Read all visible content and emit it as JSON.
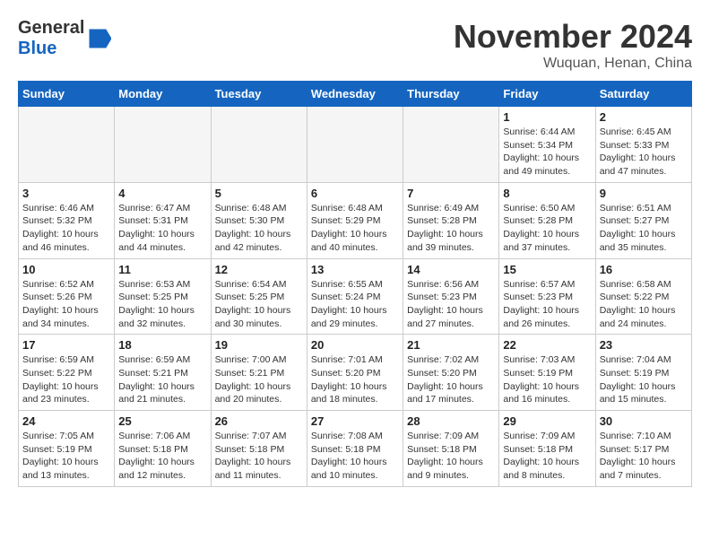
{
  "header": {
    "logo_general": "General",
    "logo_blue": "Blue",
    "month_title": "November 2024",
    "location": "Wuquan, Henan, China"
  },
  "calendar": {
    "days_of_week": [
      "Sunday",
      "Monday",
      "Tuesday",
      "Wednesday",
      "Thursday",
      "Friday",
      "Saturday"
    ],
    "weeks": [
      [
        {
          "day": "",
          "empty": true
        },
        {
          "day": "",
          "empty": true
        },
        {
          "day": "",
          "empty": true
        },
        {
          "day": "",
          "empty": true
        },
        {
          "day": "",
          "empty": true
        },
        {
          "day": "1",
          "sunrise": "Sunrise: 6:44 AM",
          "sunset": "Sunset: 5:34 PM",
          "daylight": "Daylight: 10 hours and 49 minutes."
        },
        {
          "day": "2",
          "sunrise": "Sunrise: 6:45 AM",
          "sunset": "Sunset: 5:33 PM",
          "daylight": "Daylight: 10 hours and 47 minutes."
        }
      ],
      [
        {
          "day": "3",
          "sunrise": "Sunrise: 6:46 AM",
          "sunset": "Sunset: 5:32 PM",
          "daylight": "Daylight: 10 hours and 46 minutes."
        },
        {
          "day": "4",
          "sunrise": "Sunrise: 6:47 AM",
          "sunset": "Sunset: 5:31 PM",
          "daylight": "Daylight: 10 hours and 44 minutes."
        },
        {
          "day": "5",
          "sunrise": "Sunrise: 6:48 AM",
          "sunset": "Sunset: 5:30 PM",
          "daylight": "Daylight: 10 hours and 42 minutes."
        },
        {
          "day": "6",
          "sunrise": "Sunrise: 6:48 AM",
          "sunset": "Sunset: 5:29 PM",
          "daylight": "Daylight: 10 hours and 40 minutes."
        },
        {
          "day": "7",
          "sunrise": "Sunrise: 6:49 AM",
          "sunset": "Sunset: 5:28 PM",
          "daylight": "Daylight: 10 hours and 39 minutes."
        },
        {
          "day": "8",
          "sunrise": "Sunrise: 6:50 AM",
          "sunset": "Sunset: 5:28 PM",
          "daylight": "Daylight: 10 hours and 37 minutes."
        },
        {
          "day": "9",
          "sunrise": "Sunrise: 6:51 AM",
          "sunset": "Sunset: 5:27 PM",
          "daylight": "Daylight: 10 hours and 35 minutes."
        }
      ],
      [
        {
          "day": "10",
          "sunrise": "Sunrise: 6:52 AM",
          "sunset": "Sunset: 5:26 PM",
          "daylight": "Daylight: 10 hours and 34 minutes."
        },
        {
          "day": "11",
          "sunrise": "Sunrise: 6:53 AM",
          "sunset": "Sunset: 5:25 PM",
          "daylight": "Daylight: 10 hours and 32 minutes."
        },
        {
          "day": "12",
          "sunrise": "Sunrise: 6:54 AM",
          "sunset": "Sunset: 5:25 PM",
          "daylight": "Daylight: 10 hours and 30 minutes."
        },
        {
          "day": "13",
          "sunrise": "Sunrise: 6:55 AM",
          "sunset": "Sunset: 5:24 PM",
          "daylight": "Daylight: 10 hours and 29 minutes."
        },
        {
          "day": "14",
          "sunrise": "Sunrise: 6:56 AM",
          "sunset": "Sunset: 5:23 PM",
          "daylight": "Daylight: 10 hours and 27 minutes."
        },
        {
          "day": "15",
          "sunrise": "Sunrise: 6:57 AM",
          "sunset": "Sunset: 5:23 PM",
          "daylight": "Daylight: 10 hours and 26 minutes."
        },
        {
          "day": "16",
          "sunrise": "Sunrise: 6:58 AM",
          "sunset": "Sunset: 5:22 PM",
          "daylight": "Daylight: 10 hours and 24 minutes."
        }
      ],
      [
        {
          "day": "17",
          "sunrise": "Sunrise: 6:59 AM",
          "sunset": "Sunset: 5:22 PM",
          "daylight": "Daylight: 10 hours and 23 minutes."
        },
        {
          "day": "18",
          "sunrise": "Sunrise: 6:59 AM",
          "sunset": "Sunset: 5:21 PM",
          "daylight": "Daylight: 10 hours and 21 minutes."
        },
        {
          "day": "19",
          "sunrise": "Sunrise: 7:00 AM",
          "sunset": "Sunset: 5:21 PM",
          "daylight": "Daylight: 10 hours and 20 minutes."
        },
        {
          "day": "20",
          "sunrise": "Sunrise: 7:01 AM",
          "sunset": "Sunset: 5:20 PM",
          "daylight": "Daylight: 10 hours and 18 minutes."
        },
        {
          "day": "21",
          "sunrise": "Sunrise: 7:02 AM",
          "sunset": "Sunset: 5:20 PM",
          "daylight": "Daylight: 10 hours and 17 minutes."
        },
        {
          "day": "22",
          "sunrise": "Sunrise: 7:03 AM",
          "sunset": "Sunset: 5:19 PM",
          "daylight": "Daylight: 10 hours and 16 minutes."
        },
        {
          "day": "23",
          "sunrise": "Sunrise: 7:04 AM",
          "sunset": "Sunset: 5:19 PM",
          "daylight": "Daylight: 10 hours and 15 minutes."
        }
      ],
      [
        {
          "day": "24",
          "sunrise": "Sunrise: 7:05 AM",
          "sunset": "Sunset: 5:19 PM",
          "daylight": "Daylight: 10 hours and 13 minutes."
        },
        {
          "day": "25",
          "sunrise": "Sunrise: 7:06 AM",
          "sunset": "Sunset: 5:18 PM",
          "daylight": "Daylight: 10 hours and 12 minutes."
        },
        {
          "day": "26",
          "sunrise": "Sunrise: 7:07 AM",
          "sunset": "Sunset: 5:18 PM",
          "daylight": "Daylight: 10 hours and 11 minutes."
        },
        {
          "day": "27",
          "sunrise": "Sunrise: 7:08 AM",
          "sunset": "Sunset: 5:18 PM",
          "daylight": "Daylight: 10 hours and 10 minutes."
        },
        {
          "day": "28",
          "sunrise": "Sunrise: 7:09 AM",
          "sunset": "Sunset: 5:18 PM",
          "daylight": "Daylight: 10 hours and 9 minutes."
        },
        {
          "day": "29",
          "sunrise": "Sunrise: 7:09 AM",
          "sunset": "Sunset: 5:18 PM",
          "daylight": "Daylight: 10 hours and 8 minutes."
        },
        {
          "day": "30",
          "sunrise": "Sunrise: 7:10 AM",
          "sunset": "Sunset: 5:17 PM",
          "daylight": "Daylight: 10 hours and 7 minutes."
        }
      ]
    ]
  }
}
